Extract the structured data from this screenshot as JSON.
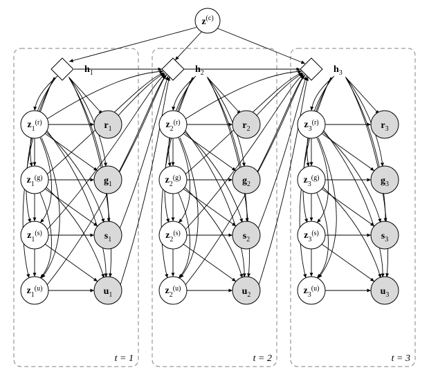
{
  "chart_data": {
    "type": "diagram",
    "title": "",
    "description": "Dynamic Bayesian-network / plate diagram over three time steps with a global context node feeding per-step deterministic h nodes and a chain of latent z variables (r,g,s,u) each emitting observed r,g,s,u.",
    "global_node": {
      "id": "zc",
      "label": "z",
      "superscript": "(c)",
      "observed": false
    },
    "time_steps": [
      1,
      2,
      3
    ],
    "per_step_nodes": [
      {
        "id": "h",
        "shape": "diamond",
        "label": "h",
        "observed": false
      },
      {
        "id": "zr",
        "shape": "circle",
        "label": "z",
        "superscript": "(r)",
        "observed": false
      },
      {
        "id": "zg",
        "shape": "circle",
        "label": "z",
        "superscript": "(g)",
        "observed": false
      },
      {
        "id": "zs",
        "shape": "circle",
        "label": "z",
        "superscript": "(s)",
        "observed": false
      },
      {
        "id": "zu",
        "shape": "circle",
        "label": "z",
        "superscript": "(u)",
        "observed": false
      },
      {
        "id": "r",
        "shape": "circle",
        "label": "r",
        "observed": true
      },
      {
        "id": "g",
        "shape": "circle",
        "label": "g",
        "observed": true
      },
      {
        "id": "s",
        "shape": "circle",
        "label": "s",
        "observed": true
      },
      {
        "id": "u",
        "shape": "circle",
        "label": "u",
        "observed": true
      }
    ],
    "within_step_edges": [
      [
        "h",
        "zr"
      ],
      [
        "h",
        "r"
      ],
      [
        "h",
        "zg"
      ],
      [
        "h",
        "g"
      ],
      [
        "h",
        "zs"
      ],
      [
        "h",
        "s"
      ],
      [
        "h",
        "zu"
      ],
      [
        "h",
        "u"
      ],
      [
        "zr",
        "r"
      ],
      [
        "zr",
        "zg"
      ],
      [
        "zr",
        "g"
      ],
      [
        "zr",
        "zs"
      ],
      [
        "zr",
        "s"
      ],
      [
        "zr",
        "zu"
      ],
      [
        "zr",
        "u"
      ],
      [
        "zg",
        "g"
      ],
      [
        "zg",
        "zs"
      ],
      [
        "zg",
        "s"
      ],
      [
        "zg",
        "zu"
      ],
      [
        "zg",
        "u"
      ],
      [
        "zs",
        "s"
      ],
      [
        "zs",
        "zu"
      ],
      [
        "zs",
        "u"
      ],
      [
        "zu",
        "u"
      ]
    ],
    "between_step_edges": [
      [
        "h",
        "h_next"
      ],
      [
        "zr",
        "h_next"
      ],
      [
        "zg",
        "h_next"
      ],
      [
        "zs",
        "h_next"
      ],
      [
        "zu",
        "h_next"
      ],
      [
        "r",
        "h_next"
      ],
      [
        "g",
        "h_next"
      ],
      [
        "s",
        "h_next"
      ],
      [
        "u",
        "h_next"
      ]
    ],
    "global_edges": [
      [
        "zc",
        "h1"
      ],
      [
        "zc",
        "h2"
      ],
      [
        "zc",
        "h3"
      ]
    ],
    "plate_labels": [
      "t = 1",
      "t = 2",
      "t = 3"
    ]
  },
  "labels": {
    "zc_base": "z",
    "zc_sup": "(c)",
    "h": "h",
    "z_base": "z",
    "sup_r": "(r)",
    "sup_g": "(g)",
    "sup_s": "(s)",
    "sup_u": "(u)",
    "r": "r",
    "g": "g",
    "s": "s",
    "u": "u",
    "plate1": "t = 1",
    "plate2": "t = 2",
    "plate3": "t = 3",
    "sub1": "1",
    "sub2": "2",
    "sub3": "3"
  }
}
